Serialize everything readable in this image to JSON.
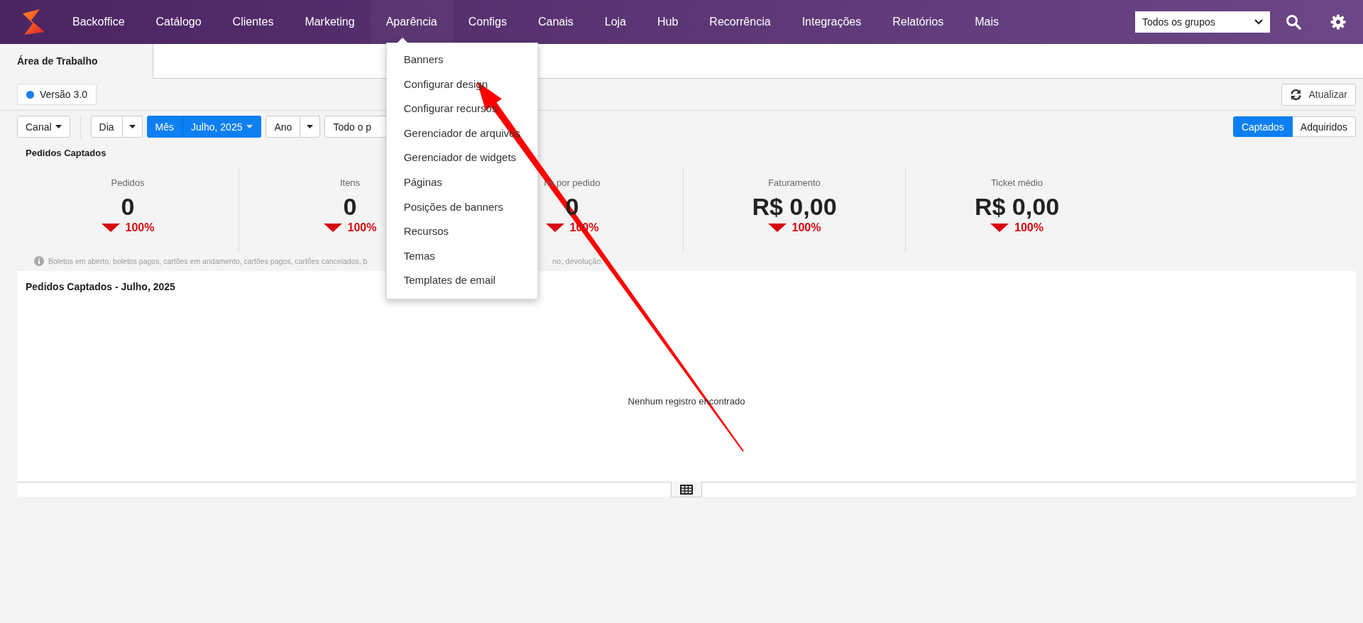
{
  "nav": {
    "items": [
      {
        "label": "Backoffice",
        "selected": false
      },
      {
        "label": "Catálogo",
        "selected": false
      },
      {
        "label": "Clientes",
        "selected": false
      },
      {
        "label": "Marketing",
        "selected": false
      },
      {
        "label": "Aparência",
        "selected": true
      },
      {
        "label": "Configs",
        "selected": false
      },
      {
        "label": "Canais",
        "selected": false
      },
      {
        "label": "Loja",
        "selected": false
      },
      {
        "label": "Hub",
        "selected": false
      },
      {
        "label": "Recorrência",
        "selected": false
      },
      {
        "label": "Integrações",
        "selected": false
      },
      {
        "label": "Relatórios",
        "selected": false
      },
      {
        "label": "Mais",
        "selected": false
      }
    ],
    "group_select": {
      "value": "Todos os grupos"
    }
  },
  "dropdown_menu": {
    "items": [
      "Banners",
      "Configurar design",
      "Configurar recursos",
      "Gerenciador de arquivos",
      "Gerenciador de widgets",
      "Páginas",
      "Posições de banners",
      "Recursos",
      "Temas",
      "Templates de email"
    ]
  },
  "tabs": [
    {
      "label": "Área de Trabalho",
      "selected": true
    }
  ],
  "version_badge": {
    "label": "Versão 3.0",
    "color": "#1a7cf0"
  },
  "refresh_button": {
    "label": "Atualizar"
  },
  "filters": [
    {
      "kind": "dropdown",
      "label": "Canal",
      "selected": false
    },
    {
      "kind": "split",
      "label": "Dia",
      "selected": false
    },
    {
      "kind": "split",
      "label": "Mês",
      "value": "Julho, 2025",
      "selected": true
    },
    {
      "kind": "split",
      "label": "Ano",
      "selected": false
    },
    {
      "kind": "plain",
      "label": "Todo o p",
      "selected": false
    }
  ],
  "mode_toggle": [
    {
      "label": "Captados",
      "selected": true
    },
    {
      "label": "Adquiridos",
      "selected": false
    }
  ],
  "section_title": "Pedidos Captados",
  "stats": [
    {
      "label": "Pedidos",
      "value": "0",
      "change": "100%",
      "decreased": true
    },
    {
      "label": "Itens",
      "value": "0",
      "change": "100%",
      "decreased": true
    },
    {
      "label": "ns por pedido",
      "value": "0",
      "change": "100%",
      "decreased": true
    },
    {
      "label": "Faturamento",
      "value": "R$ 0,00",
      "change": "100%",
      "decreased": true
    },
    {
      "label": "Ticket médio",
      "value": "R$ 0,00",
      "change": "100%",
      "decreased": true
    }
  ],
  "note": {
    "start": "Boletos em aberto, boletos pagos, cartões em andamento, cartões pagos, cartões cancelados, b",
    "end": "no, devolução."
  },
  "chart_panel": {
    "title": "Pedidos Captados - Julho, 2025",
    "empty_message": "Nenhum registro encontrado"
  }
}
